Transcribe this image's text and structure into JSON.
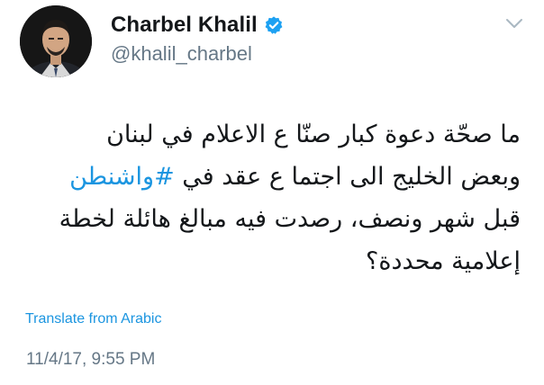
{
  "author": {
    "display_name": "Charbel Khalil",
    "handle": "@khalil_charbel",
    "verified": true
  },
  "tweet": {
    "lines": [
      {
        "text": "ما صحّة دعوة كبار صنّا ع الاعلام في لبنان"
      },
      {
        "text": "وبعض الخليج الى اجتما ع عقد في ",
        "hashtag": "#واشنطن"
      },
      {
        "text": "قبل شهر ونصف، رصدت فيه مبالغ هائلة لخطة"
      },
      {
        "text": "إعلامية محددة؟"
      }
    ]
  },
  "translate_label": "Translate from Arabic",
  "timestamp": "11/4/17, 9:55 PM",
  "colors": {
    "link": "#1b95e0",
    "text": "#14171a",
    "secondary": "#657786",
    "verified_badge": "#1da1f2"
  },
  "icons": {
    "verified": "verified-badge-icon",
    "menu": "chevron-down-icon"
  }
}
